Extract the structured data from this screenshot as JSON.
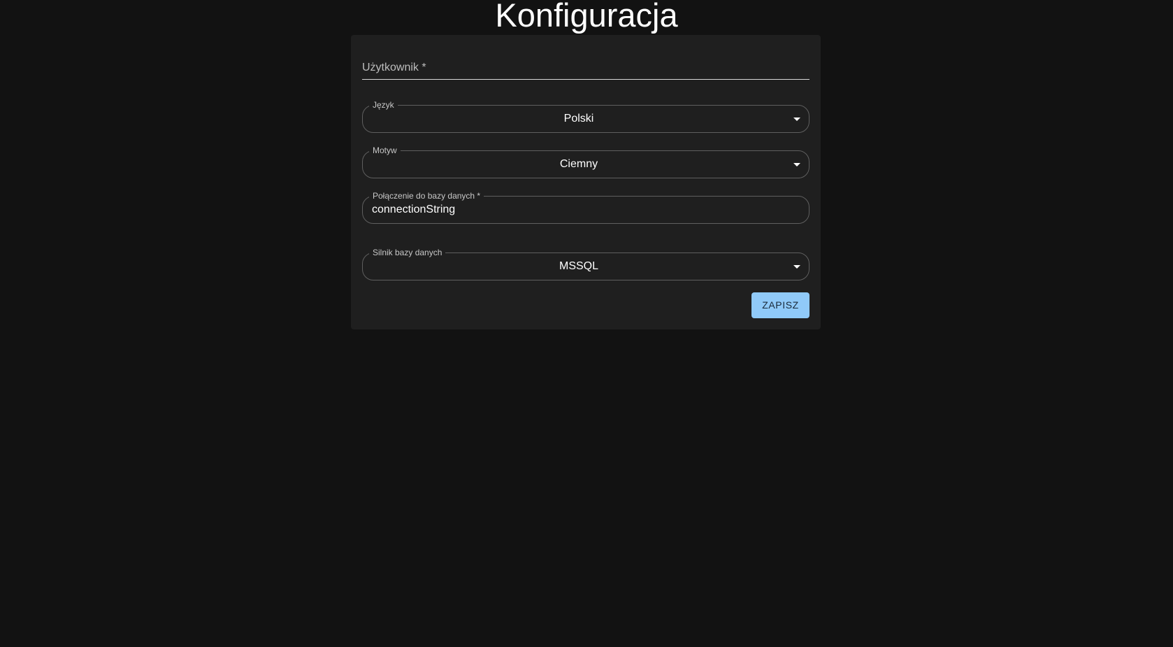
{
  "header": {
    "title": "Konfiguracja"
  },
  "form": {
    "user": {
      "label": "Użytkownik *",
      "value": ""
    },
    "language": {
      "label": "Język",
      "value": "Polski"
    },
    "theme": {
      "label": "Motyw",
      "value": "Ciemny"
    },
    "connection": {
      "label": "Połączenie do bazy danych *",
      "value": "connectionString"
    },
    "engine": {
      "label": "Silnik bazy danych",
      "value": "MSSQL"
    },
    "save_label": "ZAPISZ"
  },
  "colors": {
    "background": "#121212",
    "card": "#1f1f1f",
    "accent": "#90caf9"
  },
  "icons": {
    "dropdown": "caret-down-icon"
  }
}
